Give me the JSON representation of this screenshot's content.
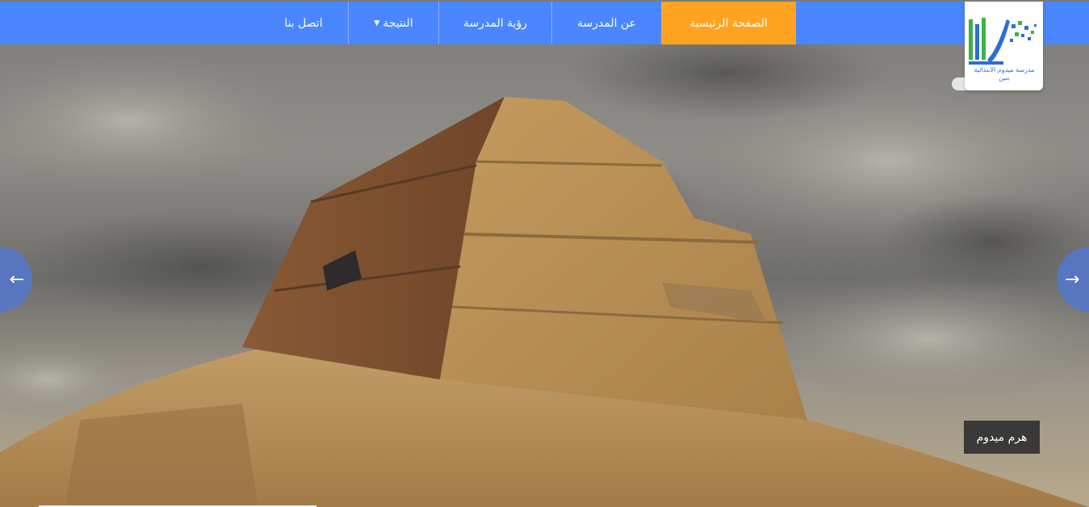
{
  "nav": {
    "items": [
      {
        "label": "الصفحة الرئيسية",
        "active": true
      },
      {
        "label": "عن المدرسة"
      },
      {
        "label": "رؤية المدرسة"
      },
      {
        "label": "النتيجة",
        "dropdown": true
      },
      {
        "label": "اتصل بنا"
      }
    ]
  },
  "logo": {
    "text": "مدرسة ميدوم الابتدائية بنين",
    "icon": "books-logo-icon"
  },
  "slider": {
    "caption": "هرم ميدوم",
    "prev_icon": "arrow-left-icon",
    "next_icon": "arrow-right-icon",
    "prev_glyph": "←",
    "next_glyph": "→"
  },
  "colors": {
    "nav_bg": "#4a86ff",
    "active_bg": "#ffa321",
    "logo_green": "#3cb34a",
    "logo_blue": "#2a6fd6"
  }
}
